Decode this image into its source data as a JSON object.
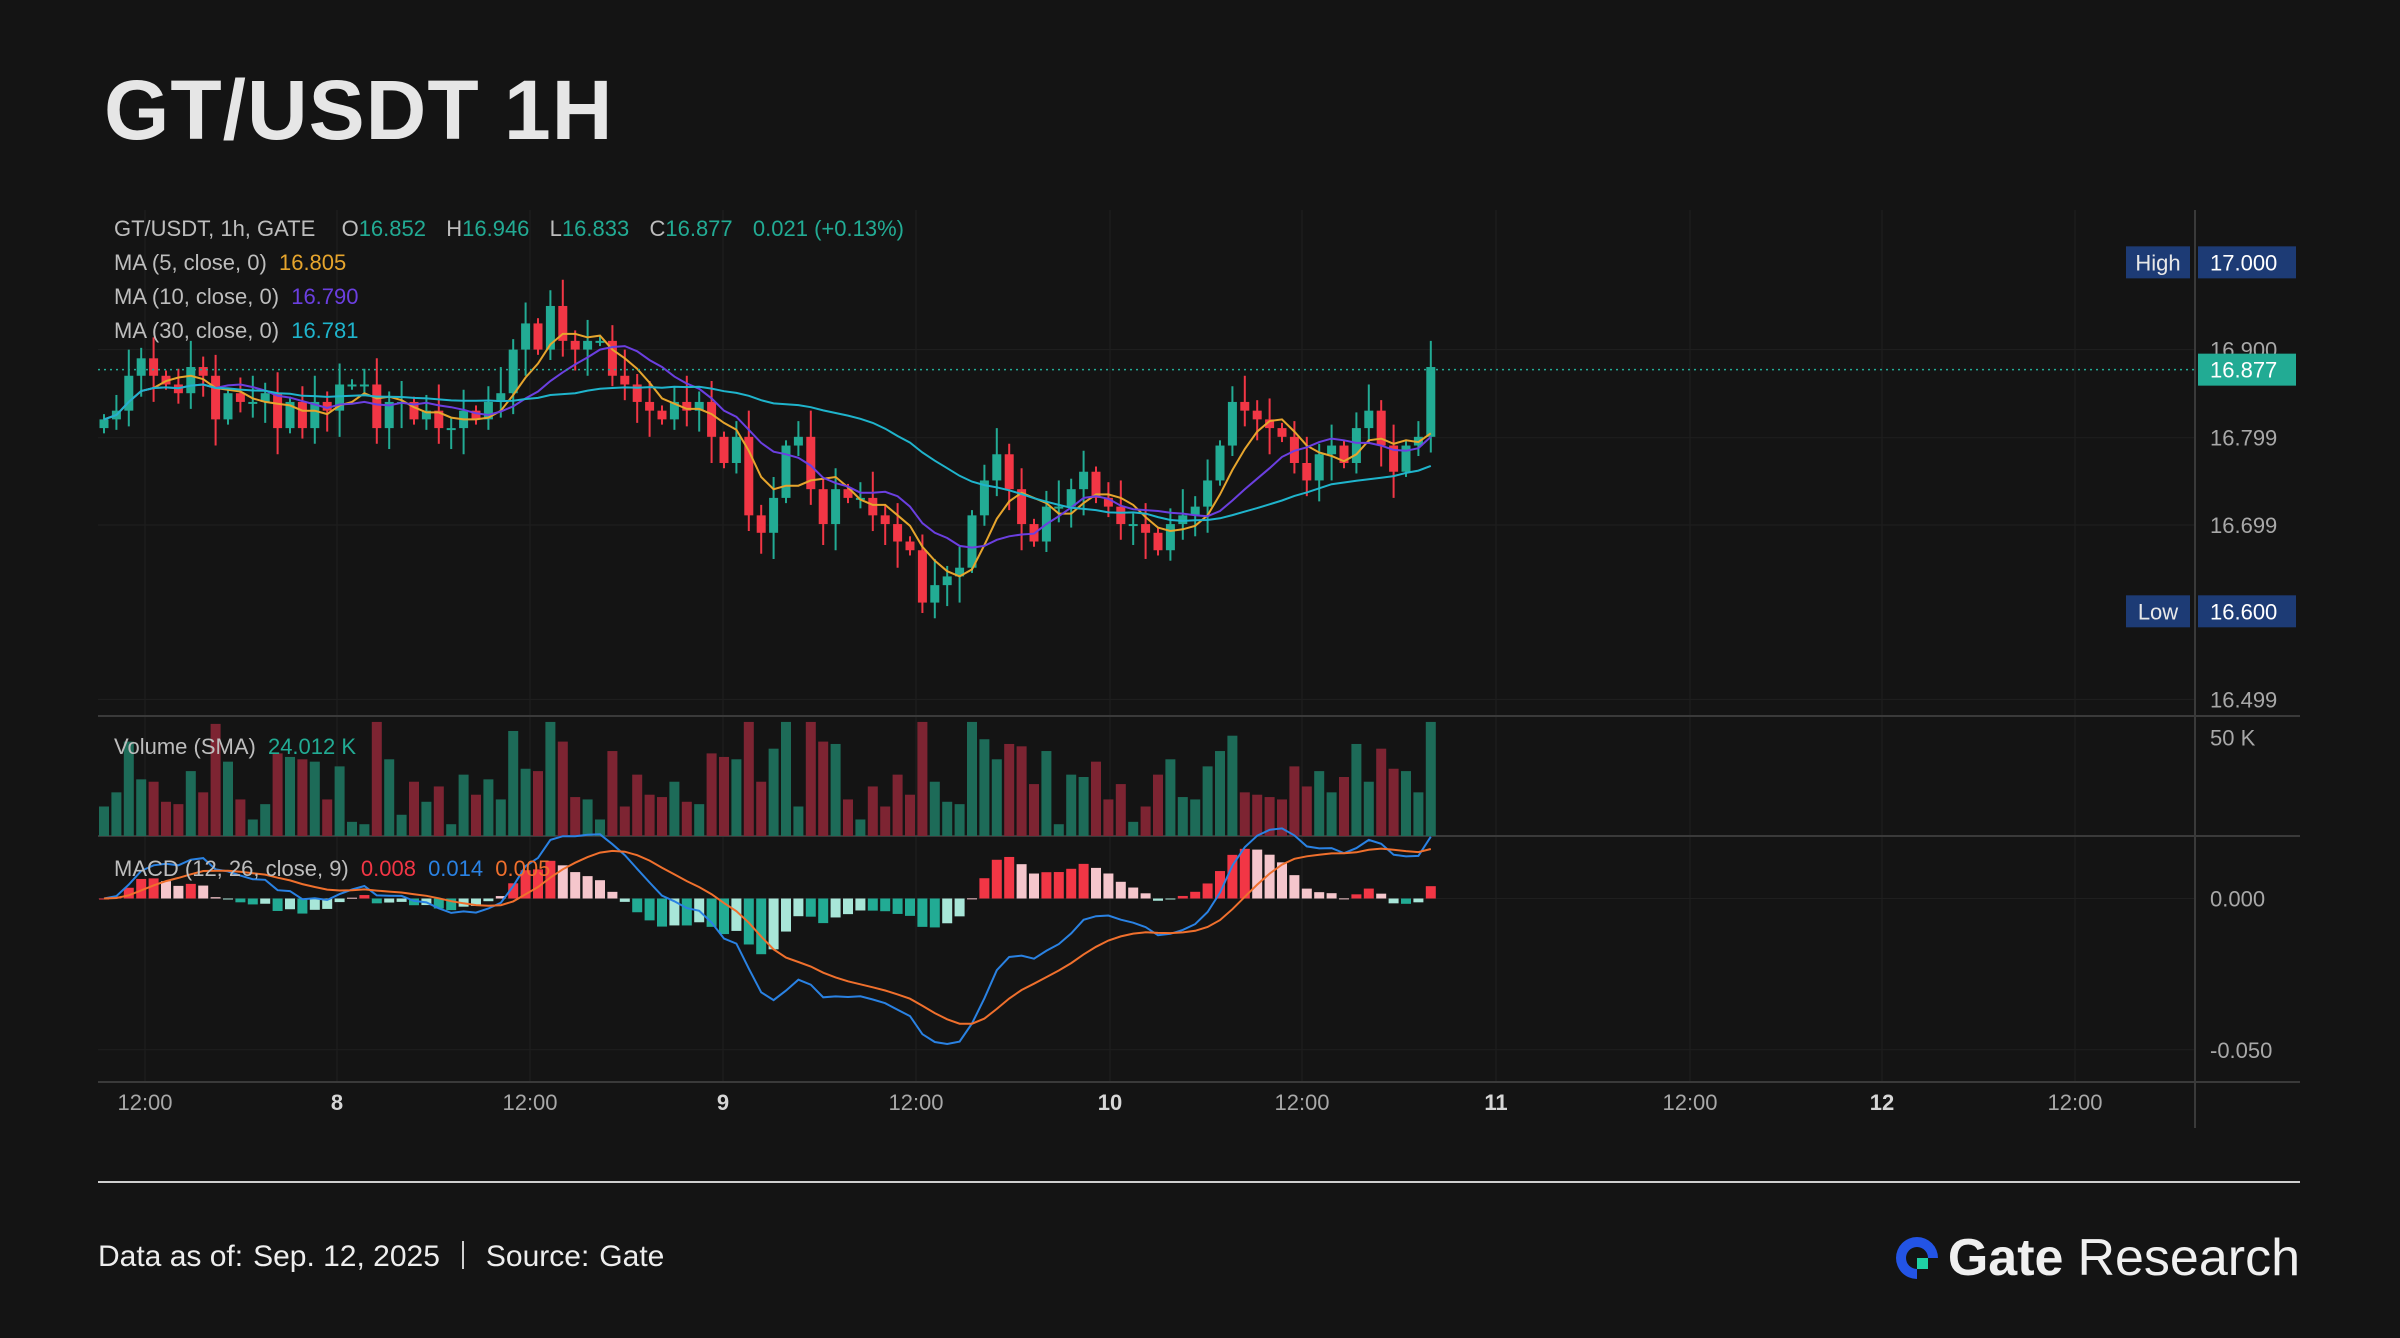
{
  "title": "GT/USDT 1H",
  "legend": {
    "symbol": "GT/USDT, 1h, GATE",
    "o_label": "O",
    "o": "16.852",
    "h_label": "H",
    "h": "16.946",
    "l_label": "L",
    "l": "16.833",
    "c_label": "C",
    "c": "16.877",
    "change": "0.021 (+0.13%)",
    "ma5_label": "MA (5, close, 0)",
    "ma5_value": "16.805",
    "ma10_label": "MA (10, close, 0)",
    "ma10_value": "16.790",
    "ma30_label": "MA (30, close, 0)",
    "ma30_value": "16.781",
    "volume_label": "Volume (SMA)",
    "volume_value": "24.012 K",
    "macd_label": "MACD (12, 26, close, 9)",
    "macd_hist": "0.008",
    "macd_line": "0.014",
    "macd_signal": "0.005"
  },
  "footer": {
    "data_as_of_label": "Data as of:",
    "data_as_of_value": "Sep. 12, 2025",
    "source_label": "Source:",
    "source_value": "Gate",
    "brand_gate": "Gate",
    "brand_research": "Research"
  },
  "colors": {
    "up": "#22ab94",
    "down": "#f23645",
    "ma5": "#e6a52d",
    "ma10": "#6b3fe0",
    "ma30": "#1fb4cc",
    "macd": "#2a82e3",
    "signal": "#f0702d",
    "background": "#141414"
  },
  "chart_data": {
    "type": "candlestick",
    "price_axis": {
      "ticks": [
        "16.900",
        "16.799",
        "16.699",
        "16.499"
      ],
      "range": [
        16.48,
        17.06
      ]
    },
    "markers": [
      {
        "label": "High",
        "value": "17.000"
      },
      {
        "label": "Low",
        "value": "16.600"
      },
      {
        "label": "",
        "value": "16.877"
      }
    ],
    "x_ticks": [
      "12:00",
      "8",
      "12:00",
      "9",
      "12:00",
      "10",
      "12:00",
      "11",
      "12:00",
      "12",
      "12:00"
    ],
    "volume_axis": {
      "ticks": [
        "50 K"
      ]
    },
    "macd_axis": {
      "ticks": [
        "0.000",
        "-0.050"
      ],
      "range": [
        -0.06,
        0.02
      ]
    },
    "candle_count": 108,
    "closes": [
      16.82,
      16.83,
      16.87,
      16.89,
      16.87,
      16.86,
      16.85,
      16.88,
      16.87,
      16.82,
      16.85,
      16.84,
      16.84,
      16.85,
      16.81,
      16.84,
      16.81,
      16.84,
      16.83,
      16.86,
      16.86,
      16.86,
      16.81,
      16.84,
      16.84,
      16.82,
      16.83,
      16.81,
      16.81,
      16.83,
      16.82,
      16.84,
      16.85,
      16.9,
      16.93,
      16.9,
      16.95,
      16.91,
      16.9,
      16.91,
      16.91,
      16.87,
      16.86,
      16.84,
      16.83,
      16.82,
      16.84,
      16.83,
      16.84,
      16.8,
      16.77,
      16.8,
      16.71,
      16.69,
      16.73,
      16.79,
      16.8,
      16.74,
      16.7,
      16.74,
      16.73,
      16.73,
      16.71,
      16.7,
      16.68,
      16.67,
      16.61,
      16.63,
      16.64,
      16.65,
      16.71,
      16.75,
      16.78,
      16.74,
      16.7,
      16.68,
      16.72,
      16.72,
      16.74,
      16.76,
      16.73,
      16.72,
      16.7,
      16.7,
      16.69,
      16.67,
      16.7,
      16.71,
      16.72,
      16.75,
      16.79,
      16.84,
      16.83,
      16.82,
      16.81,
      16.8,
      16.77,
      16.75,
      16.78,
      16.79,
      16.77,
      16.81,
      16.83,
      16.79,
      16.76,
      16.79,
      16.8,
      16.88
    ],
    "volume_sma": 24012,
    "macd_last": {
      "histogram": 0.008,
      "macd": 0.014,
      "signal": 0.005
    }
  }
}
